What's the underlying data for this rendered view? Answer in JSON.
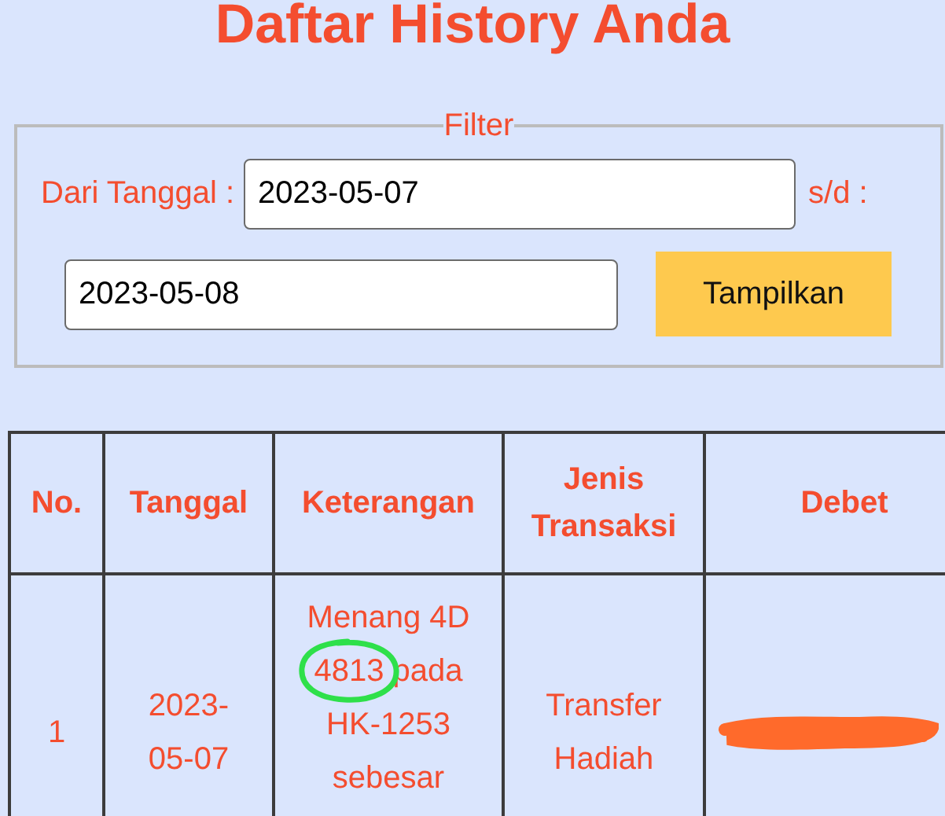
{
  "title": "Daftar History Anda",
  "filter": {
    "legend": "Filter",
    "from_label": "Dari Tanggal :",
    "from_value": "2023-05-07",
    "to_label": "s/d :",
    "to_value": "2023-05-08",
    "button": "Tampilkan"
  },
  "table": {
    "columns": [
      "No.",
      "Tanggal",
      "Keterangan",
      "Jenis Transaksi",
      "Debet"
    ],
    "rows": [
      {
        "no": "1",
        "tanggal": "2023-05-07",
        "keterangan": "Menang 4D 4813 pada HK-1253 sebesar",
        "jenis": "Transfer Hadiah",
        "debet_redacted": true
      }
    ]
  }
}
